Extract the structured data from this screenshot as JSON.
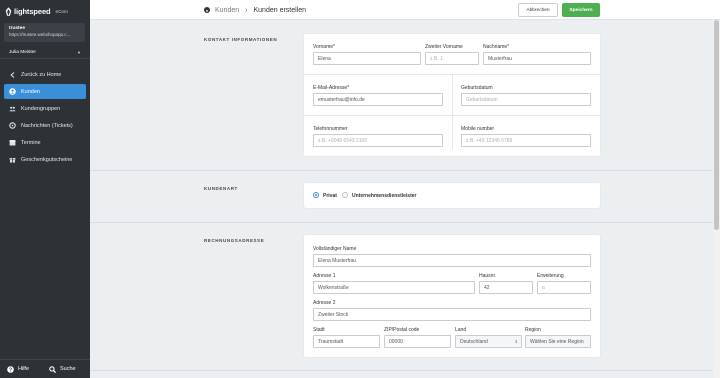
{
  "app": {
    "brand": "lightspeed",
    "product": "eCom"
  },
  "shop": {
    "name": "trustee",
    "url": "https://trustee.webshopapp.c..."
  },
  "user": {
    "name": "Julia Meister"
  },
  "sidebar": {
    "back_label": "Zurück zu Home",
    "items": [
      {
        "label": "Kunden",
        "icon": "customer-icon",
        "active": true
      },
      {
        "label": "Kundengruppen",
        "icon": "group-icon"
      },
      {
        "label": "Nachrichten (Tickets)",
        "icon": "messages-icon"
      },
      {
        "label": "Termine",
        "icon": "calendar-icon"
      },
      {
        "label": "Geschenkgutscheine",
        "icon": "gift-icon"
      }
    ],
    "help_label": "Hilfe",
    "search_label": "Suche"
  },
  "header": {
    "breadcrumb_parent": "Kunden",
    "breadcrumb_current": "Kunden erstellen",
    "cancel_label": "Abbrechen",
    "save_label": "Speichern"
  },
  "contact": {
    "section_title": "KONTAKT INFORMATIONEN",
    "firstname_label": "Vorname*",
    "firstname_value": "Elena",
    "middlename_label": "Zweiter Vorname",
    "middlename_placeholder": "z.B. J.",
    "lastname_label": "Nachname*",
    "lastname_value": "Musterfrau",
    "email_label": "E-Mail-Adresse*",
    "email_value": "emusterfrau@info.de",
    "birthdate_label": "Geburtsdatum",
    "birthdate_placeholder": "Geburtsdatum",
    "phone_label": "Telefonnummer",
    "phone_placeholder": "z.B. +0049 6543 2100",
    "mobile_label": "Mobile number",
    "mobile_placeholder": "z.B. +49 12345 6789"
  },
  "customer_type": {
    "section_title": "KUNDENART",
    "options": [
      {
        "label": "Privat",
        "selected": true
      },
      {
        "label": "Unternehmensdienstleister",
        "selected": false
      }
    ]
  },
  "billing": {
    "section_title": "RECHNUNGSADRESSE",
    "fullname_label": "Vollständiger Name",
    "fullname_value": "Elena Musterfrau",
    "address1_label": "Adresse 1",
    "address1_value": "Wolkenstraße",
    "house_label": "Hausnr.",
    "house_value": "42",
    "extension_label": "Erweiterung",
    "extension_placeholder": "a",
    "address2_label": "Adresse 2",
    "address2_value": "Zweiter Stock",
    "city_label": "Stadt",
    "city_value": "Traumstadt",
    "zip_label": "ZIP/Postal code",
    "zip_value": "00000",
    "country_label": "Land",
    "country_value": "Deutschland",
    "region_label": "Region",
    "region_value": "Wählen Sie eine Region"
  },
  "colors": {
    "accent": "#3a8fd9",
    "save": "#4caf50",
    "sidebar": "#2d3237"
  }
}
